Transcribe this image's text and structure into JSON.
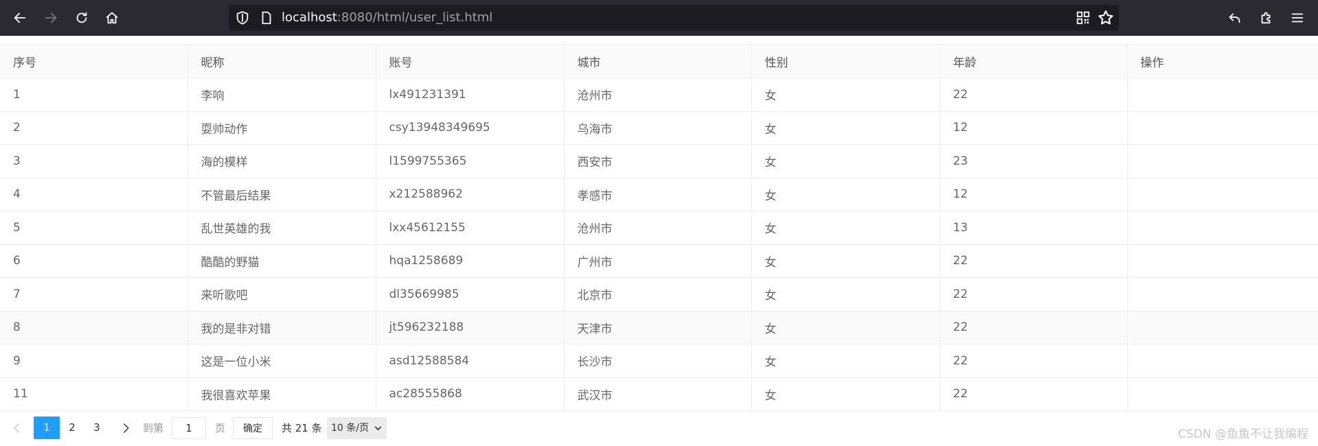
{
  "browser": {
    "url_host": "localhost",
    "url_rest": ":8080/html/user_list.html"
  },
  "table": {
    "columns": [
      "序号",
      "昵称",
      "账号",
      "城市",
      "性别",
      "年龄",
      "操作"
    ],
    "rows": [
      [
        "1",
        "李响",
        "lx491231391",
        "沧州市",
        "女",
        "22",
        ""
      ],
      [
        "2",
        "耍帅动作",
        "csy13948349695",
        "乌海市",
        "女",
        "12",
        ""
      ],
      [
        "3",
        "海的模样",
        "l1599755365",
        "西安市",
        "女",
        "23",
        ""
      ],
      [
        "4",
        "不管最后结果",
        "x212588962",
        "孝感市",
        "女",
        "12",
        ""
      ],
      [
        "5",
        "乱世英雄的我",
        "lxx45612155",
        "沧州市",
        "女",
        "13",
        ""
      ],
      [
        "6",
        "酷酷的野猫",
        "hqa1258689",
        "广州市",
        "女",
        "22",
        ""
      ],
      [
        "7",
        "来听歌吧",
        "dl35669985",
        "北京市",
        "女",
        "22",
        ""
      ],
      [
        "8",
        "我的是非对错",
        "jt596232188",
        "天津市",
        "女",
        "22",
        ""
      ],
      [
        "9",
        "这是一位小米",
        "asd12588584",
        "长沙市",
        "女",
        "22",
        ""
      ],
      [
        "11",
        "我很喜欢苹果",
        "ac28555868",
        "武汉市",
        "女",
        "22",
        ""
      ]
    ]
  },
  "pagination": {
    "pages": [
      "1",
      "2",
      "3"
    ],
    "current": "1",
    "goto_label": "到第",
    "goto_value": "1",
    "page_unit": "页",
    "confirm_label": "确定",
    "total_text": "共 21 条",
    "page_size": "10 条/页"
  },
  "watermark": "CSDN @鱼鱼不让我编程",
  "icons": {
    "back": "back-arrow-icon",
    "forward": "forward-arrow-icon",
    "reload": "reload-icon",
    "home": "home-icon",
    "shield": "shield-icon",
    "page": "page-icon",
    "qr": "qr-code-icon",
    "star": "bookmark-star-icon",
    "undo": "undo-icon",
    "extensions": "puzzle-icon",
    "menu": "hamburger-menu-icon"
  },
  "colors": {
    "chrome_bg": "#2b2a33",
    "urlbar_bg": "#1c1b22",
    "accent": "#1e9fff",
    "header_bg": "#fafafa"
  }
}
